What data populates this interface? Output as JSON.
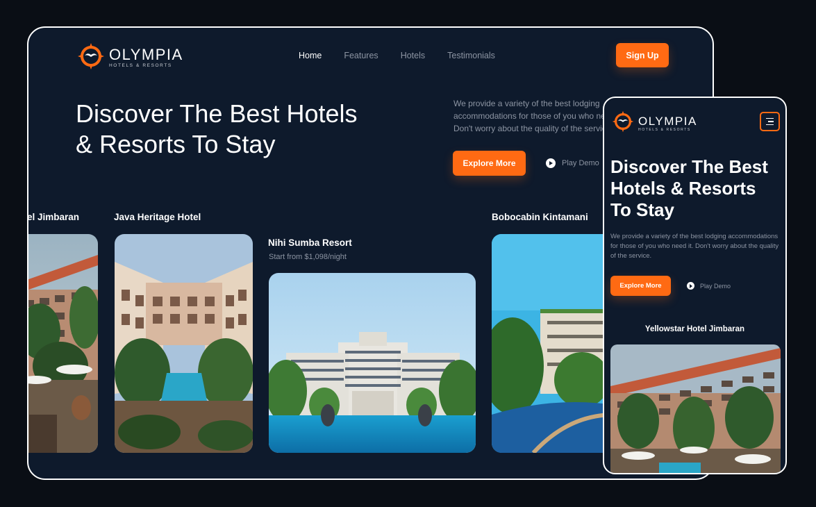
{
  "brand": {
    "name": "OLYMPIA",
    "tagline": "HOTELS & RESORTS"
  },
  "nav": {
    "items": [
      "Home",
      "Features",
      "Hotels",
      "Testimonials"
    ],
    "active": "Home"
  },
  "header": {
    "signup_label": "Sign Up"
  },
  "hero": {
    "title_line1": "Discover The Best Hotels",
    "title_line2": "& Resorts To Stay",
    "description": "We provide a variety of the best lodging accommodations for those of you who need it. Don't worry about the quality of the service.",
    "description_visible": "We provide a variety of the best lodging accommodations for those of you who need it. Don't worry about the quality of the service.",
    "explore_label": "Explore More",
    "play_label": "Play Demo"
  },
  "hotels": [
    {
      "name": "el Jimbaran"
    },
    {
      "name": "Java Heritage Hotel"
    },
    {
      "name": "Nihi Sumba Resort",
      "price": "Start from $1,098/night"
    },
    {
      "name": "Bobocabin Kintamani"
    }
  ],
  "mobile": {
    "title_line1": "Discover The Best",
    "title_line2": "Hotels & Resorts",
    "title_line3": "To Stay",
    "description": "We provide a variety of the best lodging accommodations for those of you who need it. Don't worry about the quality of the service.",
    "explore_label": "Explore More",
    "play_label": "Play Demo",
    "card_title": "Yellowstar Hotel Jimbaran"
  },
  "colors": {
    "accent": "#ff6a13",
    "background": "#0e1a2c",
    "page": "#0a0e15"
  }
}
